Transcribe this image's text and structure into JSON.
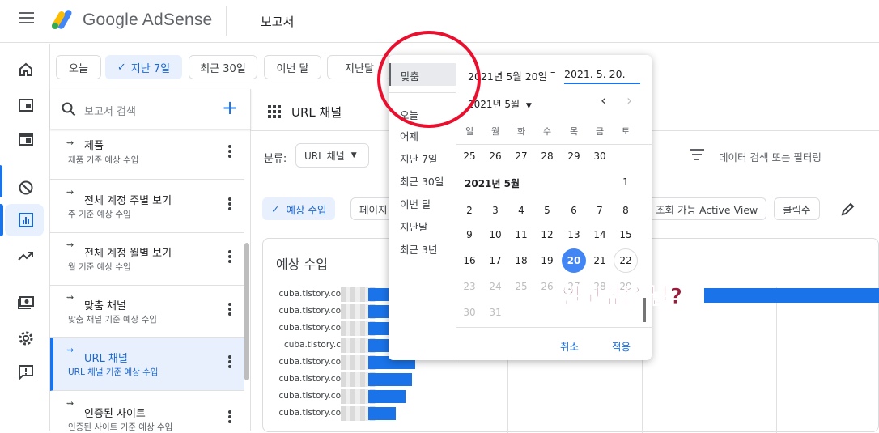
{
  "app": {
    "brand": "Google AdSense",
    "page_title": "보고서"
  },
  "date_chips": [
    {
      "label": "오늘",
      "selected": false
    },
    {
      "label": "지난 7일",
      "selected": true
    },
    {
      "label": "최근 30일",
      "selected": false
    },
    {
      "label": "이번 달",
      "selected": false
    },
    {
      "label": "지난달",
      "selected": false
    }
  ],
  "reports": {
    "search_placeholder": "보고서 검색",
    "items": [
      {
        "title": "제품",
        "subtitle": "제품 기준 예상 수입"
      },
      {
        "title": "전체 계정 주별 보기",
        "subtitle": "주 기준 예상 수입"
      },
      {
        "title": "전체 계정 월별 보기",
        "subtitle": "월 기준 예상 수입"
      },
      {
        "title": "맞춤 채널",
        "subtitle": "맞춤 채널 기준 예상 수입"
      },
      {
        "title": "URL 채널",
        "subtitle": "URL 채널 기준 예상 수입",
        "active": true
      },
      {
        "title": "인증된 사이트",
        "subtitle": "인증된 사이트 기준 예상 수입"
      }
    ]
  },
  "main": {
    "title": "URL 채널",
    "classification_label": "분류:",
    "classification_value": "URL 채널",
    "filter_placeholder": "데이터 검색 또는 필터링",
    "metrics": [
      {
        "label": "예상 수입",
        "selected": true
      },
      {
        "label": "페이지"
      },
      {
        "label": "조회 가능 Active View"
      },
      {
        "label": "클릭수"
      }
    ],
    "chart_title": "예상 수입",
    "bar_labels": [
      "cuba.tistory.co",
      "cuba.tistory.co",
      "cuba.tistory.co",
      "cuba.tistory.c",
      "cuba.tistory.co",
      "cuba.tistory.co",
      "cuba.tistory.co",
      "cuba.tistory.co"
    ]
  },
  "picker": {
    "presets": [
      "맞춤",
      "오늘",
      "어제",
      "지난 7일",
      "최근 30일",
      "이번 달",
      "지난달",
      "최근 3년"
    ],
    "start_date": "2021년 5월 20일",
    "dash": "–",
    "end_date": "2021. 5. 20.",
    "month_select": "2021년 5월",
    "weekdays": [
      "일",
      "월",
      "화",
      "수",
      "목",
      "금",
      "토"
    ],
    "prev_month_days": [
      "25",
      "26",
      "27",
      "28",
      "29",
      "30"
    ],
    "month_label": "2021년 5월",
    "days": [
      "1",
      "2",
      "3",
      "4",
      "5",
      "6",
      "7",
      "8",
      "9",
      "10",
      "11",
      "12",
      "13",
      "14",
      "15",
      "16",
      "17",
      "18",
      "19",
      "20",
      "21",
      "22",
      "23",
      "24",
      "25",
      "26",
      "27",
      "28",
      "29",
      "30",
      "31"
    ],
    "selected_day": 20,
    "today_day": 22,
    "cancel": "취소",
    "apply": "적용"
  },
  "annotation": "알고싶은 날?"
}
